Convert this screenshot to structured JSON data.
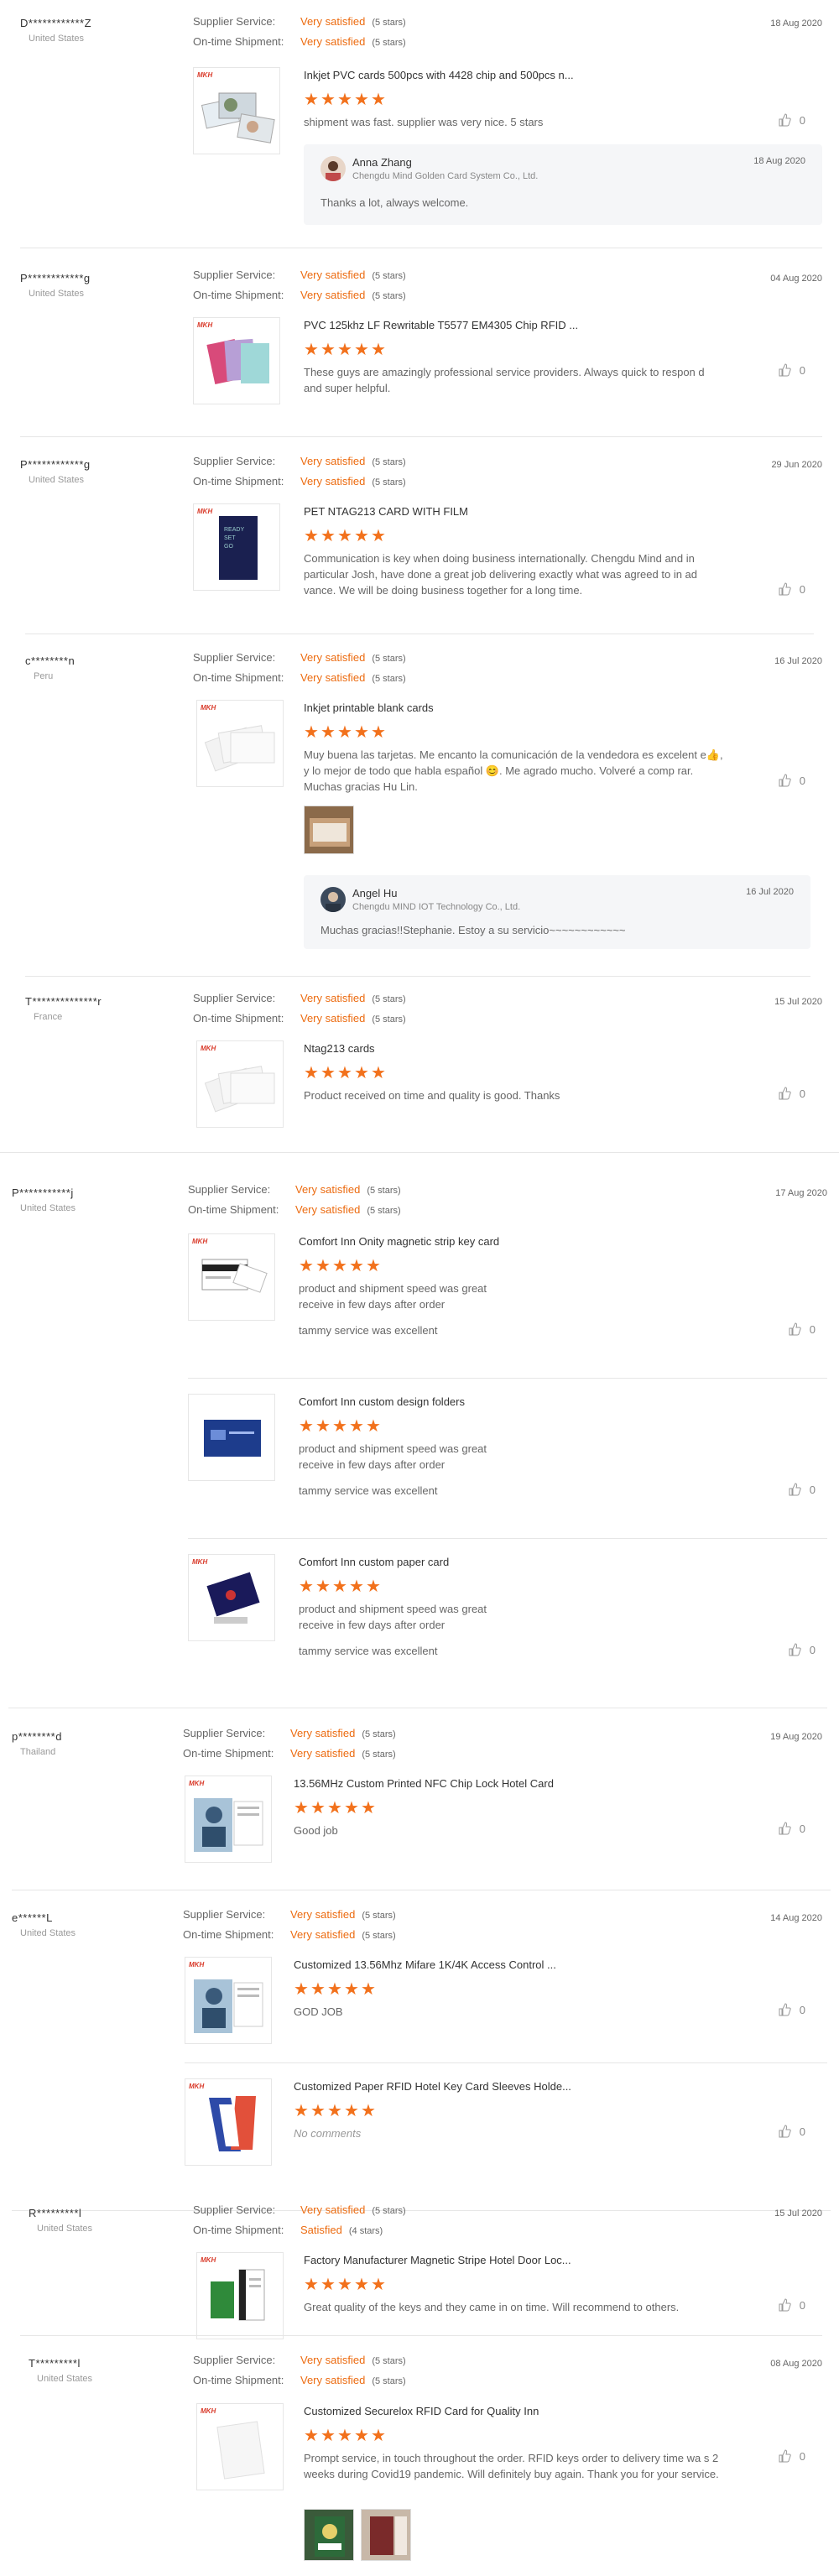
{
  "labels": {
    "supplier_service": "Supplier Service:",
    "on_time_shipment": "On-time Shipment:",
    "five_stars": "(5 stars)",
    "four_stars": "(4 stars)",
    "very_satisfied": "Very satisfied",
    "satisfied": "Satisfied",
    "star_glyph": "★"
  },
  "reviews": [
    {
      "buyer": "D************Z",
      "country": "United States",
      "date": "18 Aug 2020",
      "supplier_service": "Very satisfied",
      "supplier_stars": "(5 stars)",
      "on_time": "Very satisfied",
      "on_time_stars": "(5 stars)",
      "items": [
        {
          "title": "Inkjet PVC cards 500pcs with 4428 chip and 500pcs n...",
          "rating": 5,
          "comment": "shipment was fast. supplier was very nice. 5 stars",
          "likes": "0",
          "brand": "MKH",
          "thumb_icon": "photo-cards-icon"
        }
      ],
      "reply": {
        "name": "Anna Zhang",
        "company": "Chengdu Mind Golden Card System Co., Ltd.",
        "date": "18 Aug 2020",
        "text": "Thanks a lot, always welcome."
      }
    },
    {
      "buyer": "P************g",
      "country": "United States",
      "date": "04 Aug 2020",
      "supplier_service": "Very satisfied",
      "supplier_stars": "(5 stars)",
      "on_time": "Very satisfied",
      "on_time_stars": "(5 stars)",
      "items": [
        {
          "title": "PVC 125khz LF Rewritable T5577 EM4305 Chip RFID ...",
          "rating": 5,
          "comment": "These guys are amazingly professional service providers. Always quick to respon d and super helpful.",
          "likes": "0",
          "brand": "MKH",
          "thumb_icon": "colored-cards-icon"
        }
      ]
    },
    {
      "buyer": "P************g",
      "country": "United States",
      "date": "29 Jun 2020",
      "supplier_service": "Very satisfied",
      "supplier_stars": "(5 stars)",
      "on_time": "Very satisfied",
      "on_time_stars": "(5 stars)",
      "items": [
        {
          "title": "PET NTAG213 CARD WITH FILM",
          "rating": 5,
          "comment": "Communication is key when doing business internationally. Chengdu Mind and in particular Josh, have done a great job delivering exactly what was agreed to in ad vance. We will be doing business together for a long time.",
          "likes": "0",
          "brand": "MKH",
          "thumb_icon": "dark-card-icon"
        }
      ]
    },
    {
      "buyer": "c********n",
      "country": "Peru",
      "date": "16 Jul 2020",
      "supplier_service": "Very satisfied",
      "supplier_stars": "(5 stars)",
      "on_time": "Very satisfied",
      "on_time_stars": "(5 stars)",
      "items": [
        {
          "title": "Inkjet printable blank cards",
          "rating": 5,
          "comment": "Muy buena las tarjetas. Me encanto la comunicación de la vendedora es excelent e👍, y lo mejor de todo que habla español 😊. Me agrado mucho. Volveré a comp rar. Muchas gracias Hu Lin.",
          "likes": "0",
          "brand": "MKH",
          "thumb_icon": "blank-cards-icon"
        }
      ],
      "reply": {
        "name": "Angel Hu",
        "company": "Chengdu MIND IOT Technology Co., Ltd.",
        "date": "16 Jul 2020",
        "text": "Muchas gracias!!Stephanie. Estoy a su servicio~~~~~~~~~~~~"
      }
    },
    {
      "buyer": "T**************r",
      "country": "France",
      "date": "15 Jul 2020",
      "supplier_service": "Very satisfied",
      "supplier_stars": "(5 stars)",
      "on_time": "Very satisfied",
      "on_time_stars": "(5 stars)",
      "items": [
        {
          "title": "Ntag213 cards",
          "rating": 5,
          "comment": "Product received on time and quality is good. Thanks",
          "likes": "0",
          "brand": "MKH",
          "thumb_icon": "blank-cards-icon"
        }
      ]
    },
    {
      "buyer": "P***********j",
      "country": "United States",
      "date": "17 Aug 2020",
      "supplier_service": "Very satisfied",
      "supplier_stars": "(5 stars)",
      "on_time": "Very satisfied",
      "on_time_stars": "(5 stars)",
      "items": [
        {
          "title": "Comfort Inn Onity magnetic strip key card",
          "rating": 5,
          "comment": "product and shipment speed was great\nreceive in few days after order",
          "extra": "tammy service was excellent",
          "likes": "0",
          "brand": "MKH",
          "thumb_icon": "magnetic-card-icon"
        },
        {
          "title": "Comfort Inn custom design folders",
          "rating": 5,
          "comment": "product and shipment speed was great\nreceive in few days after order",
          "extra": "tammy service was excellent",
          "likes": "0",
          "brand": "",
          "thumb_icon": "folder-icon"
        },
        {
          "title": "Comfort Inn custom paper card",
          "rating": 5,
          "comment": "product and shipment speed was great\nreceive in few days after order",
          "extra": "tammy service was excellent",
          "likes": "0",
          "brand": "MKH",
          "thumb_icon": "paper-card-icon"
        }
      ]
    },
    {
      "buyer": "p********d",
      "country": "Thailand",
      "date": "19 Aug 2020",
      "supplier_service": "Very satisfied",
      "supplier_stars": "(5 stars)",
      "on_time": "Very satisfied",
      "on_time_stars": "(5 stars)",
      "items": [
        {
          "title": "13.56MHz Custom Printed NFC Chip Lock Hotel Card",
          "rating": 5,
          "comment": "Good job",
          "likes": "0",
          "brand": "MKH",
          "thumb_icon": "hotel-card-icon"
        }
      ]
    },
    {
      "buyer": "e******L",
      "country": "United States",
      "date": "14 Aug 2020",
      "supplier_service": "Very satisfied",
      "supplier_stars": "(5 stars)",
      "on_time": "Very satisfied",
      "on_time_stars": "(5 stars)",
      "items": [
        {
          "title": "Customized 13.56Mhz Mifare 1K/4K Access Control ...",
          "rating": 5,
          "comment": "GOD JOB",
          "likes": "0",
          "brand": "MKH",
          "thumb_icon": "hotel-card-icon"
        },
        {
          "title": "Customized Paper RFID Hotel Key Card Sleeves Holde...",
          "rating": 5,
          "comment": "No comments",
          "muted": true,
          "likes": "0",
          "brand": "MKH",
          "thumb_icon": "sleeve-icon"
        }
      ]
    },
    {
      "buyer": "R*********l",
      "country": "United States",
      "date": "15 Jul 2020",
      "supplier_service": "Very satisfied",
      "supplier_stars": "(5 stars)",
      "on_time": "Satisfied",
      "on_time_stars": "(4 stars)",
      "items": [
        {
          "title": "Factory Manufacturer Magnetic Stripe Hotel Door Loc...",
          "rating": 5,
          "comment": "Great quality of the keys and they came in on time. Will recommend to others.",
          "likes": "0",
          "brand": "MKH",
          "thumb_icon": "stripe-card-icon"
        }
      ]
    },
    {
      "buyer": "T*********l",
      "country": "United States",
      "date": "08 Aug 2020",
      "supplier_service": "Very satisfied",
      "supplier_stars": "(5 stars)",
      "on_time": "Very satisfied",
      "on_time_stars": "(5 stars)",
      "items": [
        {
          "title": "Customized Securelox RFID Card for Quality Inn",
          "rating": 5,
          "comment": "Prompt service, in touch throughout the order. RFID keys order to delivery time wa s 2 weeks during Covid19 pandemic. Will definitely buy again. Thank you for your service.",
          "likes": "0",
          "brand": "MKH",
          "thumb_icon": "white-card-icon"
        }
      ]
    }
  ]
}
